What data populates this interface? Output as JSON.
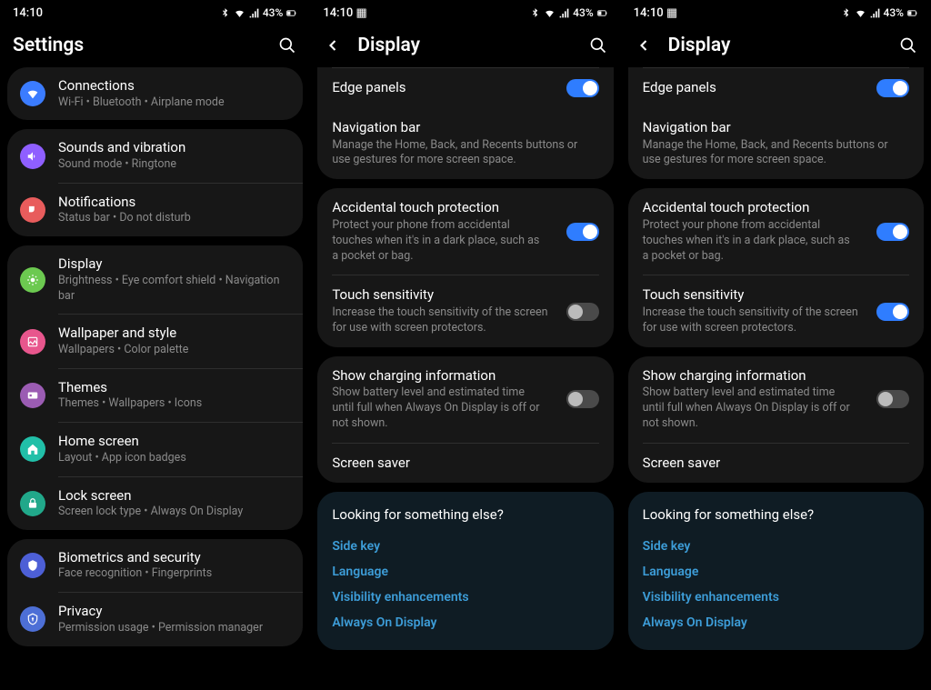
{
  "statusbar": {
    "time": "14:10",
    "battery": "43%"
  },
  "phone1": {
    "title": "Settings",
    "groups": [
      {
        "rows": [
          {
            "icon": "ic-wifi",
            "title": "Connections",
            "sub": "Wi-Fi  •  Bluetooth  •  Airplane mode"
          }
        ]
      },
      {
        "rows": [
          {
            "icon": "ic-sound",
            "title": "Sounds and vibration",
            "sub": "Sound mode  •  Ringtone"
          },
          {
            "icon": "ic-notif",
            "title": "Notifications",
            "sub": "Status bar  •  Do not disturb"
          }
        ]
      },
      {
        "rows": [
          {
            "icon": "ic-display",
            "title": "Display",
            "sub": "Brightness  •  Eye comfort shield  •  Navigation bar"
          },
          {
            "icon": "ic-wallpaper",
            "title": "Wallpaper and style",
            "sub": "Wallpapers  •  Color palette"
          },
          {
            "icon": "ic-theme",
            "title": "Themes",
            "sub": "Themes  •  Wallpapers  •  Icons"
          },
          {
            "icon": "ic-home",
            "title": "Home screen",
            "sub": "Layout  •  App icon badges"
          },
          {
            "icon": "ic-lock",
            "title": "Lock screen",
            "sub": "Screen lock type  •  Always On Display"
          }
        ]
      },
      {
        "rows": [
          {
            "icon": "ic-bio",
            "title": "Biometrics and security",
            "sub": "Face recognition  •  Fingerprints"
          },
          {
            "icon": "ic-privacy",
            "title": "Privacy",
            "sub": "Permission usage  •  Permission manager"
          }
        ]
      }
    ]
  },
  "display": {
    "title": "Display",
    "items": {
      "edge": {
        "title": "Edge panels"
      },
      "nav": {
        "title": "Navigation bar",
        "desc": "Manage the Home, Back, and Recents buttons or use gestures for more screen space."
      },
      "accidental": {
        "title": "Accidental touch protection",
        "desc": "Protect your phone from accidental touches when it's in a dark place, such as a pocket or bag."
      },
      "touch": {
        "title": "Touch sensitivity",
        "desc": "Increase the touch sensitivity of the screen for use with screen protectors."
      },
      "charging": {
        "title": "Show charging information",
        "desc": "Show battery level and estimated time until full when Always On Display is off or not shown."
      },
      "saver": {
        "title": "Screen saver"
      }
    },
    "looking": {
      "title": "Looking for something else?",
      "links": {
        "side": "Side key",
        "lang": "Language",
        "vis": "Visibility enhancements",
        "aod": "Always On Display"
      }
    }
  },
  "phone2": {
    "touchSensOn": false
  },
  "phone3": {
    "touchSensOn": true
  }
}
